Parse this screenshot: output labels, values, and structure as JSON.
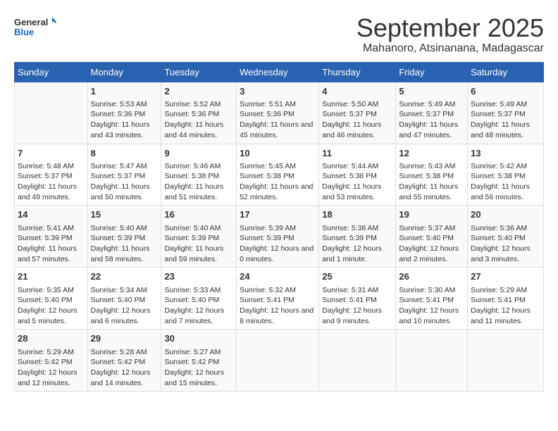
{
  "logo": {
    "line1": "General",
    "line2": "Blue"
  },
  "title": "September 2025",
  "subtitle": "Mahanoro, Atsinanana, Madagascar",
  "days_of_week": [
    "Sunday",
    "Monday",
    "Tuesday",
    "Wednesday",
    "Thursday",
    "Friday",
    "Saturday"
  ],
  "weeks": [
    [
      {
        "day": "",
        "sunrise": "",
        "sunset": "",
        "daylight": ""
      },
      {
        "day": "1",
        "sunrise": "Sunrise: 5:53 AM",
        "sunset": "Sunset: 5:36 PM",
        "daylight": "Daylight: 11 hours and 43 minutes."
      },
      {
        "day": "2",
        "sunrise": "Sunrise: 5:52 AM",
        "sunset": "Sunset: 5:36 PM",
        "daylight": "Daylight: 11 hours and 44 minutes."
      },
      {
        "day": "3",
        "sunrise": "Sunrise: 5:51 AM",
        "sunset": "Sunset: 5:36 PM",
        "daylight": "Daylight: 11 hours and 45 minutes."
      },
      {
        "day": "4",
        "sunrise": "Sunrise: 5:50 AM",
        "sunset": "Sunset: 5:37 PM",
        "daylight": "Daylight: 11 hours and 46 minutes."
      },
      {
        "day": "5",
        "sunrise": "Sunrise: 5:49 AM",
        "sunset": "Sunset: 5:37 PM",
        "daylight": "Daylight: 11 hours and 47 minutes."
      },
      {
        "day": "6",
        "sunrise": "Sunrise: 5:49 AM",
        "sunset": "Sunset: 5:37 PM",
        "daylight": "Daylight: 11 hours and 48 minutes."
      }
    ],
    [
      {
        "day": "7",
        "sunrise": "Sunrise: 5:48 AM",
        "sunset": "Sunset: 5:37 PM",
        "daylight": "Daylight: 11 hours and 49 minutes."
      },
      {
        "day": "8",
        "sunrise": "Sunrise: 5:47 AM",
        "sunset": "Sunset: 5:37 PM",
        "daylight": "Daylight: 11 hours and 50 minutes."
      },
      {
        "day": "9",
        "sunrise": "Sunrise: 5:46 AM",
        "sunset": "Sunset: 5:38 PM",
        "daylight": "Daylight: 11 hours and 51 minutes."
      },
      {
        "day": "10",
        "sunrise": "Sunrise: 5:45 AM",
        "sunset": "Sunset: 5:38 PM",
        "daylight": "Daylight: 11 hours and 52 minutes."
      },
      {
        "day": "11",
        "sunrise": "Sunrise: 5:44 AM",
        "sunset": "Sunset: 5:38 PM",
        "daylight": "Daylight: 11 hours and 53 minutes."
      },
      {
        "day": "12",
        "sunrise": "Sunrise: 5:43 AM",
        "sunset": "Sunset: 5:38 PM",
        "daylight": "Daylight: 11 hours and 55 minutes."
      },
      {
        "day": "13",
        "sunrise": "Sunrise: 5:42 AM",
        "sunset": "Sunset: 5:38 PM",
        "daylight": "Daylight: 11 hours and 56 minutes."
      }
    ],
    [
      {
        "day": "14",
        "sunrise": "Sunrise: 5:41 AM",
        "sunset": "Sunset: 5:39 PM",
        "daylight": "Daylight: 11 hours and 57 minutes."
      },
      {
        "day": "15",
        "sunrise": "Sunrise: 5:40 AM",
        "sunset": "Sunset: 5:39 PM",
        "daylight": "Daylight: 11 hours and 58 minutes."
      },
      {
        "day": "16",
        "sunrise": "Sunrise: 5:40 AM",
        "sunset": "Sunset: 5:39 PM",
        "daylight": "Daylight: 11 hours and 59 minutes."
      },
      {
        "day": "17",
        "sunrise": "Sunrise: 5:39 AM",
        "sunset": "Sunset: 5:39 PM",
        "daylight": "Daylight: 12 hours and 0 minutes."
      },
      {
        "day": "18",
        "sunrise": "Sunrise: 5:38 AM",
        "sunset": "Sunset: 5:39 PM",
        "daylight": "Daylight: 12 hours and 1 minute."
      },
      {
        "day": "19",
        "sunrise": "Sunrise: 5:37 AM",
        "sunset": "Sunset: 5:40 PM",
        "daylight": "Daylight: 12 hours and 2 minutes."
      },
      {
        "day": "20",
        "sunrise": "Sunrise: 5:36 AM",
        "sunset": "Sunset: 5:40 PM",
        "daylight": "Daylight: 12 hours and 3 minutes."
      }
    ],
    [
      {
        "day": "21",
        "sunrise": "Sunrise: 5:35 AM",
        "sunset": "Sunset: 5:40 PM",
        "daylight": "Daylight: 12 hours and 5 minutes."
      },
      {
        "day": "22",
        "sunrise": "Sunrise: 5:34 AM",
        "sunset": "Sunset: 5:40 PM",
        "daylight": "Daylight: 12 hours and 6 minutes."
      },
      {
        "day": "23",
        "sunrise": "Sunrise: 5:33 AM",
        "sunset": "Sunset: 5:40 PM",
        "daylight": "Daylight: 12 hours and 7 minutes."
      },
      {
        "day": "24",
        "sunrise": "Sunrise: 5:32 AM",
        "sunset": "Sunset: 5:41 PM",
        "daylight": "Daylight: 12 hours and 8 minutes."
      },
      {
        "day": "25",
        "sunrise": "Sunrise: 5:31 AM",
        "sunset": "Sunset: 5:41 PM",
        "daylight": "Daylight: 12 hours and 9 minutes."
      },
      {
        "day": "26",
        "sunrise": "Sunrise: 5:30 AM",
        "sunset": "Sunset: 5:41 PM",
        "daylight": "Daylight: 12 hours and 10 minutes."
      },
      {
        "day": "27",
        "sunrise": "Sunrise: 5:29 AM",
        "sunset": "Sunset: 5:41 PM",
        "daylight": "Daylight: 12 hours and 11 minutes."
      }
    ],
    [
      {
        "day": "28",
        "sunrise": "Sunrise: 5:29 AM",
        "sunset": "Sunset: 5:42 PM",
        "daylight": "Daylight: 12 hours and 12 minutes."
      },
      {
        "day": "29",
        "sunrise": "Sunrise: 5:28 AM",
        "sunset": "Sunset: 5:42 PM",
        "daylight": "Daylight: 12 hours and 14 minutes."
      },
      {
        "day": "30",
        "sunrise": "Sunrise: 5:27 AM",
        "sunset": "Sunset: 5:42 PM",
        "daylight": "Daylight: 12 hours and 15 minutes."
      },
      {
        "day": "",
        "sunrise": "",
        "sunset": "",
        "daylight": ""
      },
      {
        "day": "",
        "sunrise": "",
        "sunset": "",
        "daylight": ""
      },
      {
        "day": "",
        "sunrise": "",
        "sunset": "",
        "daylight": ""
      },
      {
        "day": "",
        "sunrise": "",
        "sunset": "",
        "daylight": ""
      }
    ]
  ]
}
